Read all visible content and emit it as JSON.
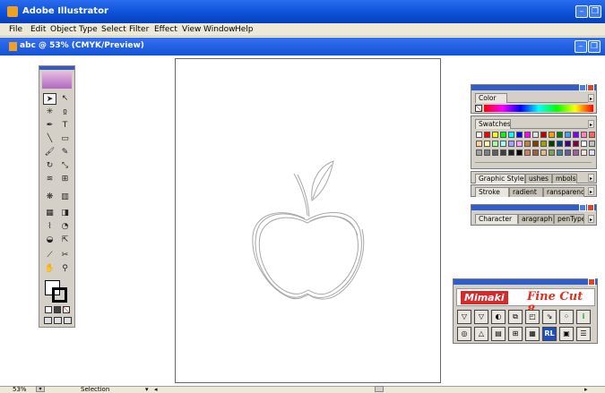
{
  "window": {
    "title": "Adobe Illustrator",
    "controls": [
      "minimize",
      "restore",
      "close"
    ]
  },
  "menu": [
    "File",
    "Edit",
    "Object",
    "Type",
    "Select",
    "Filter",
    "Effect",
    "View",
    "Window",
    "Help"
  ],
  "document": {
    "title": "abc @ 53% (CMYK/Preview)"
  },
  "toolbox": {
    "tools": [
      "selection-tool",
      "direct-selection-tool",
      "magic-wand-tool",
      "lasso-tool",
      "pen-tool",
      "type-tool",
      "line-tool",
      "rectangle-tool",
      "paintbrush-tool",
      "pencil-tool",
      "rotate-tool",
      "scale-tool",
      "warp-tool",
      "free-transform-tool",
      "symbol-sprayer-tool",
      "column-graph-tool",
      "mesh-tool",
      "gradient-tool",
      "eyedropper-tool",
      "blend-tool",
      "live-paint-tool",
      "live-paint-selection-tool",
      "scissors-tool",
      "slice-tool",
      "hand-tool",
      "zoom-tool"
    ]
  },
  "panels": {
    "color": {
      "tab": "Color"
    },
    "swatches": {
      "tab": "Swatches"
    },
    "graphic_styles": {
      "tabs": [
        "Graphic Styles",
        "ushes",
        "mbols"
      ]
    },
    "stroke": {
      "tabs": [
        "Stroke",
        "radient",
        "ransparency"
      ]
    },
    "character": {
      "tabs": [
        "Character",
        "aragraph",
        "penType"
      ]
    }
  },
  "swatch_colors": [
    "#ffffff",
    "#ff0000",
    "#ffff00",
    "#00ff00",
    "#00ffff",
    "#0000ff",
    "#ff00ff",
    "#e0e0e0",
    "#c00000",
    "#ffa000",
    "#008000",
    "#40a0ff",
    "#8000ff",
    "#ff80c0",
    "#ff6060",
    "#ffd0a0",
    "#ffffa0",
    "#a0ffa0",
    "#a0ffff",
    "#a0a0ff",
    "#ffa0ff",
    "#c08040",
    "#804000",
    "#a0a000",
    "#004000",
    "#004080",
    "#400080",
    "#800040",
    "#ffffff",
    "#c0c0c0",
    "#a0a0a0",
    "#808080",
    "#606060",
    "#404040",
    "#202020",
    "#000000",
    "#d08060",
    "#a06040",
    "#e0c080",
    "#80a060",
    "#4080a0",
    "#6060a0",
    "#a060a0",
    "#ffe0e0",
    "#e0e0ff"
  ],
  "plugin": {
    "brand": "Mimaki",
    "product": "Fine Cut 8",
    "buttons": [
      "plot",
      "plot-all",
      "preview",
      "copy",
      "area",
      "register-mark",
      "align",
      "i-info",
      "contour",
      "triangle-mark",
      "page",
      "frame",
      "mesh",
      "RL",
      "layer",
      "list"
    ]
  },
  "status": {
    "zoom": "53%",
    "tool": "Selection"
  },
  "colors": {
    "titlebar": "#0b4fd6",
    "menubar": "#ece9d8",
    "panel": "#d4d0c8",
    "mimaki_red": "#d42a2a"
  }
}
